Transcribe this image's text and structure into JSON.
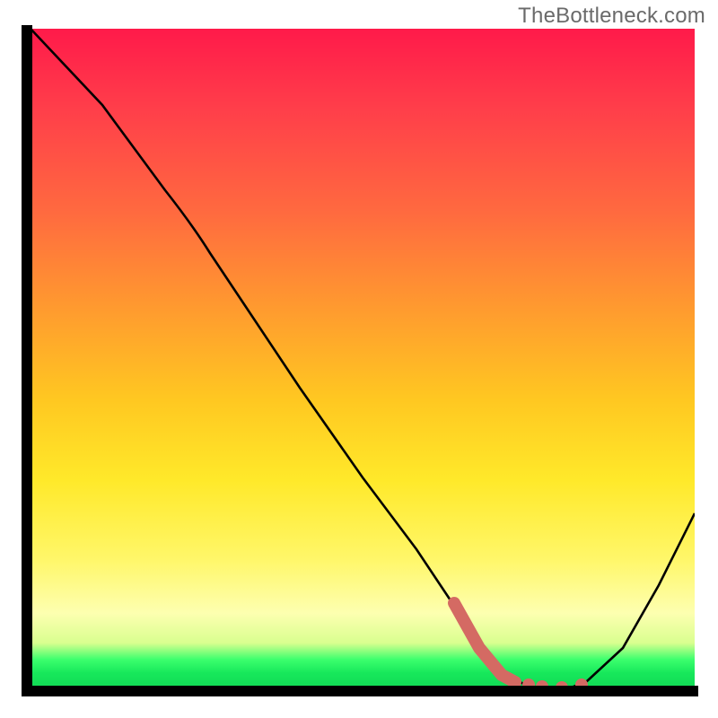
{
  "watermark": "TheBottleneck.com",
  "colors": {
    "curve": "#000000",
    "marker": "#d46a63",
    "axis": "#000000",
    "gradient_top": "#ff1a4a",
    "gradient_bottom": "#0fd653"
  },
  "chart_data": {
    "type": "line",
    "title": "",
    "xlabel": "",
    "ylabel": "",
    "xlim": [
      0,
      100
    ],
    "ylim": [
      0,
      100
    ],
    "grid": false,
    "legend": false,
    "notes": "Axes are unlabeled; plot is a bottleneck curve over a red-to-green vertical gradient. Values below are read off relative to the visible 0–100 plot box.",
    "series": [
      {
        "name": "bottleneck-curve",
        "type": "line",
        "x": [
          0,
          10,
          20,
          25,
          30,
          40,
          50,
          58,
          62,
          66,
          70,
          74,
          78,
          84,
          90,
          100
        ],
        "y": [
          100,
          88,
          75,
          71,
          63,
          50,
          37,
          26,
          19,
          11,
          4,
          1,
          0,
          2,
          10,
          28
        ]
      },
      {
        "name": "highlighted-minimum",
        "type": "scatter",
        "marker_color": "#d46a63",
        "x": [
          64,
          66,
          68,
          70,
          72,
          74,
          76,
          78,
          80,
          82
        ],
        "y": [
          14,
          11,
          8,
          5,
          3,
          2,
          1.5,
          1.2,
          1.3,
          1.5
        ]
      }
    ]
  }
}
